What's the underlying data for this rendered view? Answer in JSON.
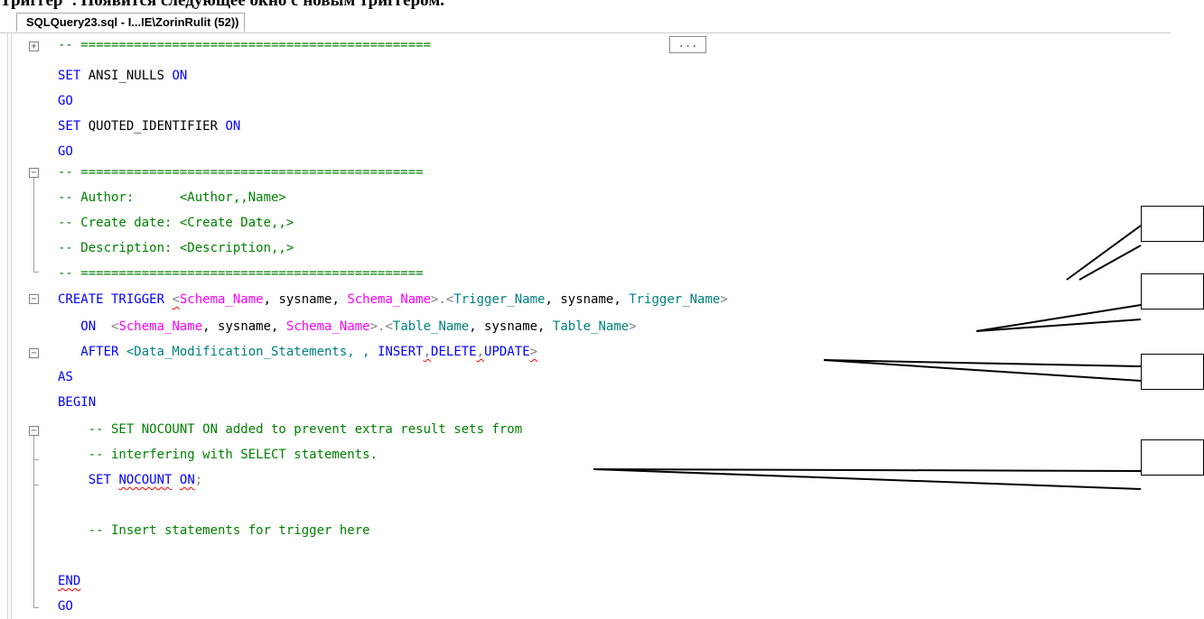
{
  "document": {
    "heading_text": "Триггер\". Появится следующее окно с новым триггером."
  },
  "tab": {
    "title": "SQLQuery23.sql - I...IE\\ZorinRulit (52))"
  },
  "editor": {
    "collapsed_indicator": "...",
    "lines": {
      "l1": "-- ==============================================",
      "l2a": "SET",
      "l2b": " ANSI_NULLS ",
      "l2c": "ON",
      "l3": "GO",
      "l4a": "SET",
      "l4b": " QUOTED_IDENTIFIER ",
      "l4c": "ON",
      "l5": "GO",
      "l6": "-- =============================================",
      "l7": "-- Author:      <Author,,Name>",
      "l8": "-- Create date: <Create Date,,>",
      "l9": "-- Description: <Description,,>",
      "l10": "-- =============================================",
      "l11_kw": "CREATE TRIGGER ",
      "l11_a": "<",
      "l11_b": "Schema_Name",
      "l11_c": ", sysname, ",
      "l11_d": "Schema_Name",
      "l11_e": ">.<",
      "l11_f": "Trigger_Name",
      "l11_g": ", sysname, ",
      "l11_h": "Trigger_Name",
      "l11_i": ">",
      "l12_kw": "   ON  ",
      "l12_a": "<",
      "l12_b": "Schema_Name",
      "l12_c": ", sysname, ",
      "l12_d": "Schema_Name",
      "l12_e": ">.<",
      "l12_f": "Table_Name",
      "l12_g": ", sysname, ",
      "l12_h": "Table_Name",
      "l12_i": ">",
      "l13_kw": "   AFTER ",
      "l13_a": "<Data_Modification_Statements, , ",
      "l13_b": "INSERT",
      "l13_c": ",",
      "l13_d": "DELETE",
      "l13_e": ",",
      "l13_f": "UPDATE",
      "l13_g": ">",
      "l14": "AS",
      "l15": "BEGIN",
      "l16": "    -- SET NOCOUNT ON added to prevent extra result sets from",
      "l17": "    -- interfering with SELECT statements.",
      "l18a": "    SET ",
      "l18b": "NOCOUNT",
      "l18c": " ",
      "l18d": "ON",
      "l18e": ";",
      "l20": "    -- Insert statements for trigger here",
      "l22": "END",
      "l23": "GO"
    }
  },
  "colors": {
    "keyword": "#0000ff",
    "comment": "#008000",
    "parameter": "#ff00ff",
    "template_name": "#008080",
    "operator": "#808080"
  }
}
